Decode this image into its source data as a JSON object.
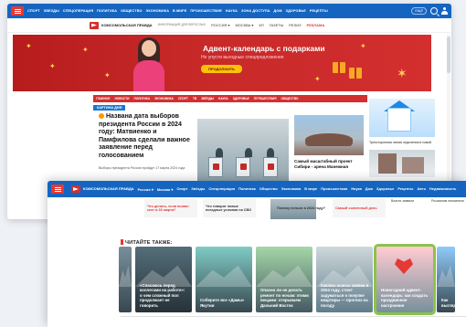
{
  "back": {
    "nav": {
      "items": [
        "СПОРТ",
        "ЗВЕЗДЫ",
        "СПЕЦОПЕРАЦИЯ",
        "ПОЛИТИКА",
        "ОБЩЕСТВО",
        "ЭКОНОМИКА",
        "В МИРЕ",
        "ПРОИСШЕСТВИЯ",
        "НАУКА",
        "ЗОНА ДОСТУПА",
        "ДОМ",
        "ЗДОРОВЬЕ",
        "РЕЦЕПТЫ"
      ],
      "more": "ЕЩЁ"
    },
    "sub": {
      "logo": "КОМСОМОЛЬСКАЯ ПРАВДА",
      "promo_label": "ИНФОРМАЦИЯ ДЛЯ ВЗРОСЛЫХ",
      "items": [
        "РОССИЯ ▾",
        "МОСКВА ▾",
        "КП",
        "ГАЗЕТЫ",
        "РЕЛИЗ"
      ],
      "highlight": "РЕКЛАМА"
    },
    "banner": {
      "title": "Адвент-календарь с подарками",
      "subtitle": "Не упусти выгодные спецпредложения",
      "button": "ПРОДОЛЖИТЬ"
    },
    "rubrics": [
      "ГЛАВНОЕ",
      "НОВОСТИ",
      "ПОЛИТИКА",
      "ЭКОНОМИКА",
      "СПОРТ",
      "ТВ",
      "ЗВЁЗДЫ",
      "НАУКА",
      "ЗДОРОВЬЕ",
      "ПУТЕШЕСТВИЯ",
      "ОБЩЕСТВО"
    ],
    "section": "КАРТИНА ДНЯ",
    "headline": "Названа дата выборов президента России в 2024 году: Матвиенко и Памфилова сделали важное заявление перед голосованием",
    "lead": "Выборы президента России пройдут 17 марта 2024 года",
    "arena_caption": "Самый масштабный проект Сибири - арена Манежная",
    "right_caption": "Трехсторонняя линия отделения в новой"
  },
  "front": {
    "nav": {
      "logo": "КОМСОМОЛЬСКАЯ ПРАВДА",
      "items": [
        "Россия ▾",
        "Москва ▾",
        "Спорт",
        "Звёзды",
        "Спецоперация",
        "Политика",
        "Общество",
        "Экономика",
        "В мире",
        "Происшествия",
        "Наука",
        "Дом",
        "Здоровье",
        "Рецепты",
        "Авто",
        "Недвижимость"
      ]
    },
    "promos": [
      "Что делать, если выпал снег в 30 марта?",
      "Что говорят новые погодные условия на СВО",
      "Почему нельзя в 2024 году?",
      "Самый солнечный день"
    ],
    "right_texts": [
      "Власти заявили",
      "Россиянам напомнили"
    ],
    "read_also": "ЧИТАЙТЕ ТАКЖЕ:",
    "cards": [
      "«Спасаюсь перед коллегами на работе»: о чем сложный пол продолжает не говорить",
      "Соберите все «Дамы» Якутии",
      "Опасно ли не делать ремонт по ночам: этими вещами: открываем Дальний Восток",
      "Каковы шансы заявки в 2024 году, стоит задуматься о покупке квартиры — прогноз на погоду",
      "Новогодний адвент-календарь: как создать праздничное настроение",
      "Как выглядит"
    ]
  }
}
